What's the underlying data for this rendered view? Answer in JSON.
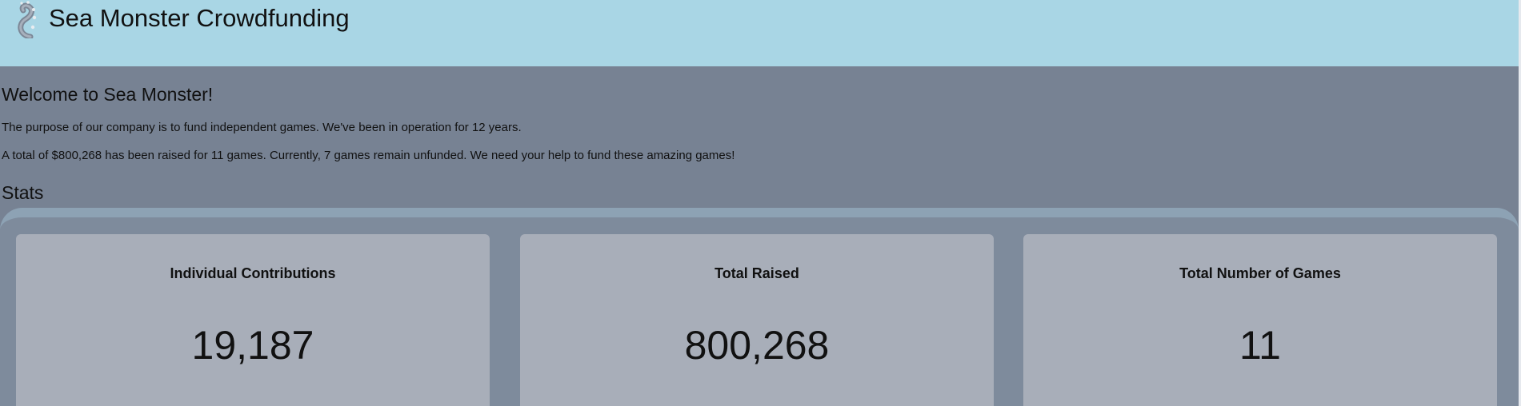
{
  "header": {
    "title": "Sea Monster Crowdfunding",
    "logo_icon": "tentacle-icon"
  },
  "intro": {
    "heading": "Welcome to Sea Monster!",
    "paragraph_1": "The purpose of our company is to fund independent games. We've been in operation for 12 years.",
    "paragraph_2": "A total of $800,268 has been raised for 11 games. Currently, 7 games remain unfunded. We need your help to fund these amazing games!"
  },
  "stats": {
    "heading": "Stats",
    "cards": [
      {
        "label": "Individual Contributions",
        "value": "19,187"
      },
      {
        "label": "Total Raised",
        "value": "800,268"
      },
      {
        "label": "Total Number of Games",
        "value": "11"
      }
    ]
  },
  "colors": {
    "header_bg": "#a9d6e5",
    "page_bg": "#778293",
    "card_bg": "#a8aeb9"
  }
}
